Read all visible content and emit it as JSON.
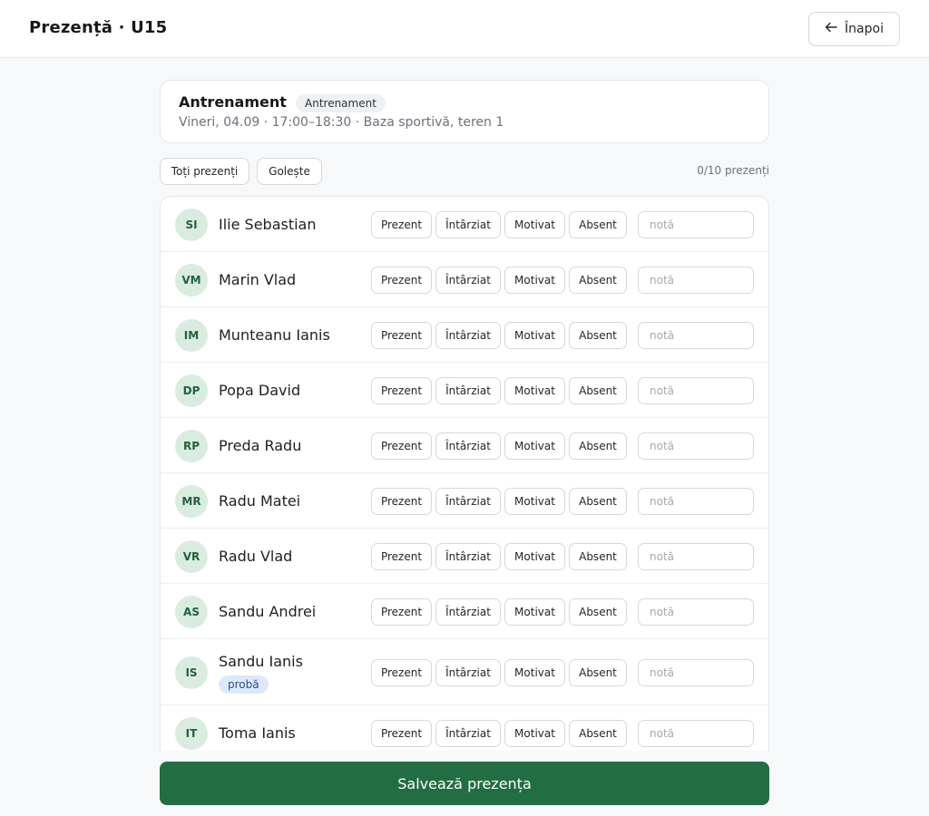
{
  "header": {
    "title": "Prezență · U15",
    "back_label": "Înapoi",
    "back_icon": "arrow-left-icon"
  },
  "session": {
    "title": "Antrenament",
    "type_badge": "Antrenament",
    "details": "Vineri, 04.09 · 17:00–18:30 · Baza sportivă, teren 1"
  },
  "actions": {
    "all_present_label": "Toți prezenți",
    "clear_label": "Golește",
    "count_text": "0/10 prezenți"
  },
  "status_options": [
    "Prezent",
    "Întârziat",
    "Motivat",
    "Absent"
  ],
  "note_placeholder": "notă",
  "players": [
    {
      "initials": "SI",
      "name": "Ilie Sebastian",
      "tag": ""
    },
    {
      "initials": "VM",
      "name": "Marin Vlad",
      "tag": ""
    },
    {
      "initials": "IM",
      "name": "Munteanu Ianis",
      "tag": ""
    },
    {
      "initials": "DP",
      "name": "Popa David",
      "tag": ""
    },
    {
      "initials": "RP",
      "name": "Preda Radu",
      "tag": ""
    },
    {
      "initials": "MR",
      "name": "Radu Matei",
      "tag": ""
    },
    {
      "initials": "VR",
      "name": "Radu Vlad",
      "tag": ""
    },
    {
      "initials": "AS",
      "name": "Sandu Andrei",
      "tag": ""
    },
    {
      "initials": "IS",
      "name": "Sandu Ianis",
      "tag": "probă"
    },
    {
      "initials": "IT",
      "name": "Toma Ianis",
      "tag": ""
    }
  ],
  "footer": {
    "save_label": "Salvează prezența"
  },
  "colors": {
    "accent": "#226d42",
    "avatar_bg": "#d9ecdf",
    "avatar_text": "#24613d",
    "tag_bg": "#dde9fb"
  }
}
